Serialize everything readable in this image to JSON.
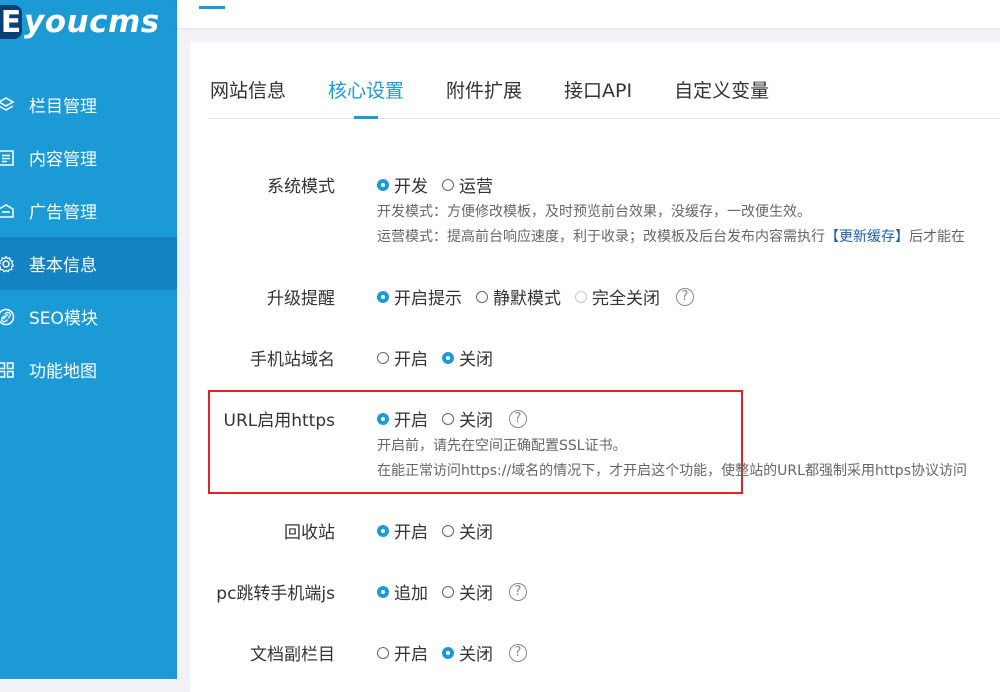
{
  "brand": {
    "mark": "E",
    "name": "youcms"
  },
  "sidebar": {
    "items": [
      {
        "label": "栏目管理",
        "icon": "layers-icon",
        "active": false
      },
      {
        "label": "内容管理",
        "icon": "document-list-icon",
        "active": false
      },
      {
        "label": "广告管理",
        "icon": "megaphone-icon",
        "active": false
      },
      {
        "label": "基本信息",
        "icon": "gear-icon",
        "active": true
      },
      {
        "label": "SEO模块",
        "icon": "link-icon",
        "active": false
      },
      {
        "label": "功能地图",
        "icon": "grid-icon",
        "active": false
      }
    ]
  },
  "tabs": [
    {
      "label": "网站信息",
      "active": false
    },
    {
      "label": "核心设置",
      "active": true
    },
    {
      "label": "附件扩展",
      "active": false
    },
    {
      "label": "接口API",
      "active": false
    },
    {
      "label": "自定义变量",
      "active": false
    }
  ],
  "settings": {
    "system_mode": {
      "label": "系统模式",
      "options": [
        {
          "label": "开发",
          "checked": true
        },
        {
          "label": "运营",
          "checked": false
        }
      ],
      "hint1": "开发模式：方便修改模板，及时预览前台效果，没缓存，一改便生效。",
      "hint2_pre": "运营模式：提高前台响应速度，利于收录；改模板及后台发布内容需执行",
      "hint2_link": "【更新缓存】",
      "hint2_post": "后才能在"
    },
    "upgrade_notice": {
      "label": "升级提醒",
      "options": [
        {
          "label": "开启提示",
          "checked": true
        },
        {
          "label": "静默模式",
          "checked": false
        },
        {
          "label": "完全关闭",
          "checked": false,
          "disabled": true
        }
      ],
      "help": "?"
    },
    "mobile_domain": {
      "label": "手机站域名",
      "options": [
        {
          "label": "开启",
          "checked": false
        },
        {
          "label": "关闭",
          "checked": true
        }
      ]
    },
    "url_https": {
      "label": "URL启用https",
      "options": [
        {
          "label": "开启",
          "checked": true
        },
        {
          "label": "关闭",
          "checked": false
        }
      ],
      "help": "?",
      "hint1": "开启前，请先在空间正确配置SSL证书。",
      "hint2": "在能正常访问https://域名的情况下，才开启这个功能，使整站的URL都强制采用https协议访问"
    },
    "recycle_bin": {
      "label": "回收站",
      "options": [
        {
          "label": "开启",
          "checked": true
        },
        {
          "label": "关闭",
          "checked": false
        }
      ]
    },
    "pc_redirect_js": {
      "label": "pc跳转手机端js",
      "options": [
        {
          "label": "追加",
          "checked": true
        },
        {
          "label": "关闭",
          "checked": false
        }
      ],
      "help": "?"
    },
    "doc_sub_column": {
      "label": "文档副栏目",
      "options": [
        {
          "label": "开启",
          "checked": false
        },
        {
          "label": "关闭",
          "checked": true
        }
      ],
      "help": "?"
    }
  },
  "colors": {
    "accent": "#1c9ad6",
    "sidebar": "#1c9ad6",
    "sidebar_active": "#1483c1",
    "highlight_box": "#e02424"
  }
}
